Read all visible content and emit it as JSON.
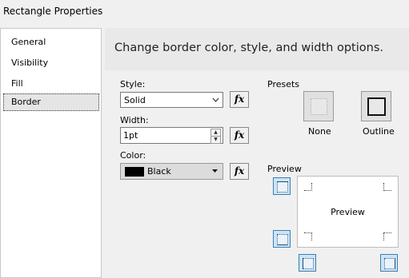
{
  "window": {
    "title": "Rectangle Properties"
  },
  "nav": {
    "items": [
      {
        "label": "General"
      },
      {
        "label": "Visibility"
      },
      {
        "label": "Fill"
      },
      {
        "label": "Border",
        "selected": true
      }
    ]
  },
  "header": {
    "text": "Change border color, style, and width options."
  },
  "style": {
    "label": "Style:",
    "value": "Solid",
    "fx": "fx"
  },
  "width": {
    "label": "Width:",
    "value": "1pt",
    "fx": "fx"
  },
  "color": {
    "label": "Color:",
    "value": "Black",
    "swatch": "#000000",
    "fx": "fx"
  },
  "presets": {
    "label": "Presets",
    "none_label": "None",
    "outline_label": "Outline"
  },
  "preview": {
    "label": "Preview",
    "text": "Preview"
  },
  "colors": {
    "selection_blue": "#cde4f7",
    "selection_border": "#3c7fb1",
    "header_bg": "#e9e9e9"
  }
}
